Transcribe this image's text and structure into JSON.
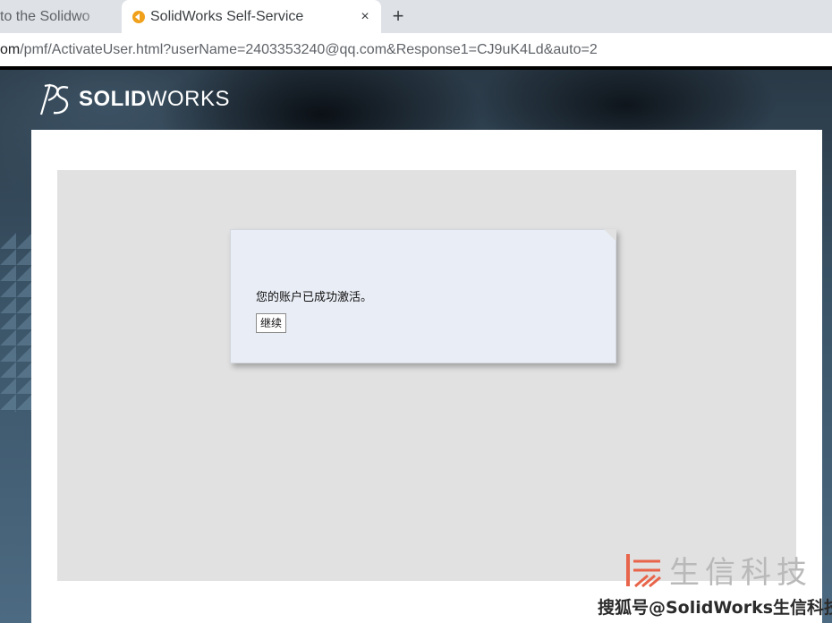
{
  "browser": {
    "tabs": [
      {
        "title": "to the Solidwo",
        "active": false
      },
      {
        "title": "SolidWorks Self-Service",
        "active": true
      }
    ],
    "close_glyph": "×",
    "new_tab_glyph": "+",
    "url_host_suffix": "om",
    "url_path": "/pmf/ActivateUser.html?userName=2403353240@qq.com&Response1=CJ9uK4Ld&auto=2"
  },
  "brand": {
    "logo_bold": "SOLID",
    "logo_light": "WORKS",
    "logo_icon": "ds-logo-icon"
  },
  "message": {
    "text": "您的账户已成功激活。",
    "continue_label": "继续"
  },
  "watermark": {
    "text": "生信科技",
    "credit": "搜狐号@SolidWorks生信科技"
  },
  "colors": {
    "favicon": "#f0a01a",
    "card": "#e9edf5",
    "panel": "#e1e1e1"
  }
}
